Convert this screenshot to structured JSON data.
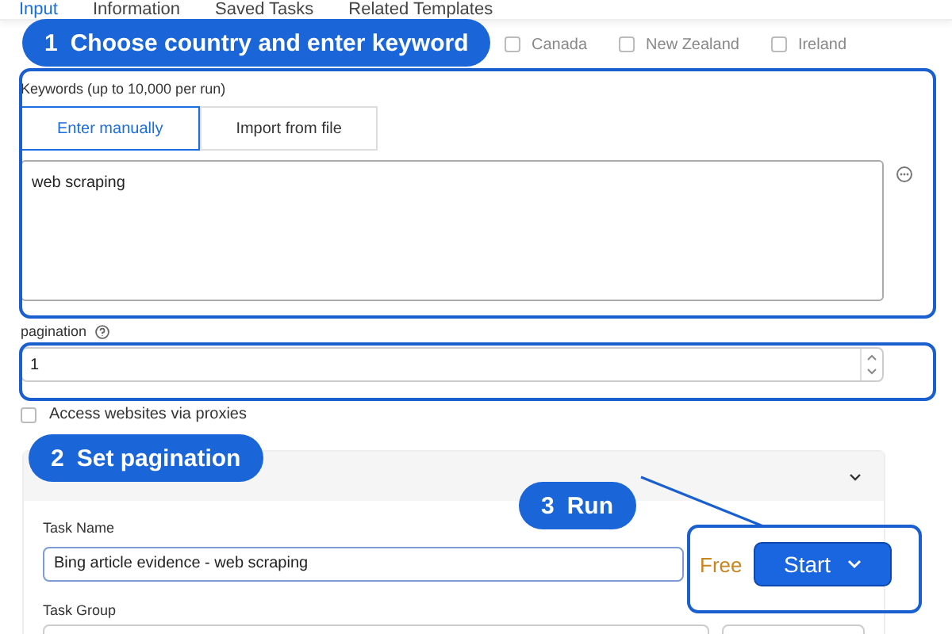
{
  "tabs": [
    {
      "label": "Input",
      "selected": true
    },
    {
      "label": "Information",
      "selected": false
    },
    {
      "label": "Saved Tasks",
      "selected": false
    },
    {
      "label": "Related Templates",
      "selected": false
    }
  ],
  "countries": [
    {
      "label": "Canada",
      "checked": false
    },
    {
      "label": "New Zealand",
      "checked": false
    },
    {
      "label": "Ireland",
      "checked": false
    }
  ],
  "keywords": {
    "label": "Keywords (up to 10,000 per run)",
    "modes": [
      {
        "label": "Enter manually",
        "selected": true
      },
      {
        "label": "Import from file",
        "selected": false
      }
    ],
    "value": "web scraping"
  },
  "pagination": {
    "label": "pagination",
    "value": "1"
  },
  "proxies": {
    "label": "Access websites via proxies",
    "checked": false
  },
  "task_name": {
    "label": "Task Name",
    "value": "Bing article evidence - web scraping"
  },
  "task_group": {
    "label": "Task Group"
  },
  "plan": "Free",
  "start_button": "Start",
  "callouts": [
    {
      "number": "1",
      "text": "Choose country and enter keyword"
    },
    {
      "number": "2",
      "text": "Set pagination"
    },
    {
      "number": "3",
      "text": "Run"
    }
  ]
}
